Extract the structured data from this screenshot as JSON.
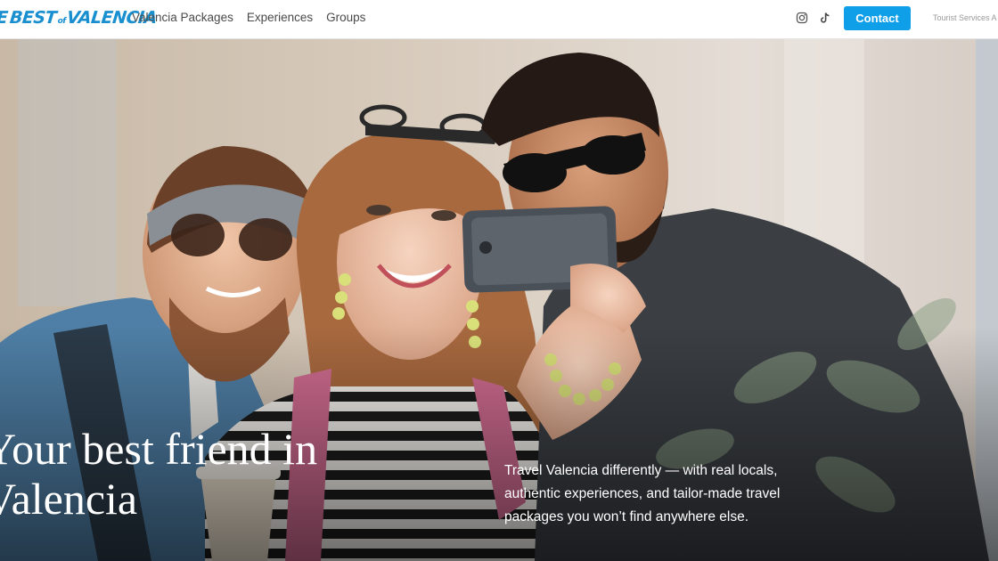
{
  "header": {
    "logo": {
      "part1": "BEST",
      "part2": "of",
      "part3": "VALENCIA",
      "prefix": "E"
    },
    "nav": [
      {
        "label": "Valencia Packages"
      },
      {
        "label": "Experiences"
      },
      {
        "label": "Groups"
      }
    ],
    "social_icons": [
      "instagram-icon",
      "tiktok-icon"
    ],
    "contact_label": "Contact",
    "tourist_services": "Tourist Services A"
  },
  "hero": {
    "title_lines": [
      "Your best friend in",
      "Valencia"
    ],
    "description_lines": [
      "Travel Valencia differently — with real locals,",
      "authentic experiences, and tailor-made travel",
      "packages you won’t find anywhere else."
    ]
  },
  "colors": {
    "accent": "#0f9ee8",
    "logo": "#1a8fd0",
    "nav_text": "#4a4a4a"
  }
}
